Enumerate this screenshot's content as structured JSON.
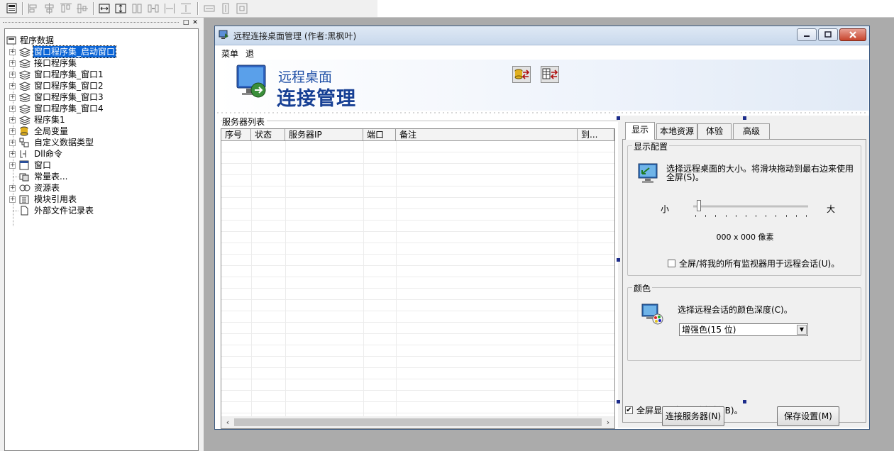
{
  "tree": {
    "root": "程序数据",
    "items": [
      {
        "label": "窗口程序集_启动窗口",
        "expand": "+",
        "selected": true,
        "icon": "layers-icon"
      },
      {
        "label": "接口程序集",
        "expand": "+",
        "icon": "layers-icon"
      },
      {
        "label": "窗口程序集_窗口1",
        "expand": "+",
        "icon": "layers-icon"
      },
      {
        "label": "窗口程序集_窗口2",
        "expand": "+",
        "icon": "layers-icon"
      },
      {
        "label": "窗口程序集_窗口3",
        "expand": "+",
        "icon": "layers-icon"
      },
      {
        "label": "窗口程序集_窗口4",
        "expand": "+",
        "icon": "layers-icon"
      },
      {
        "label": "程序集1",
        "expand": "+",
        "icon": "layers-icon"
      },
      {
        "label": "全局变量",
        "expand": "+",
        "icon": "database-icon"
      },
      {
        "label": "自定义数据类型",
        "expand": "+",
        "icon": "data-type-icon"
      },
      {
        "label": "Dll命令",
        "expand": "+",
        "icon": "dll-icon"
      },
      {
        "label": "窗口",
        "expand": "+",
        "icon": "window-icon"
      },
      {
        "label": "常量表...",
        "expand": "",
        "icon": "constant-icon"
      },
      {
        "label": "资源表",
        "expand": "+",
        "icon": "resource-icon"
      },
      {
        "label": "模块引用表",
        "expand": "+",
        "icon": "module-icon"
      },
      {
        "label": "外部文件记录表",
        "expand": "",
        "icon": "file-icon"
      }
    ]
  },
  "form": {
    "title": "远程连接桌面管理 (作者:黑枫叶)",
    "menu": [
      "菜单",
      "退"
    ],
    "banner_line1": "远程桌面",
    "banner_line2": "连接管理",
    "server_list_label": "服务器列表",
    "columns": [
      "序号",
      "状态",
      "服务器IP",
      "端口",
      "备注",
      "到..."
    ],
    "tabs": [
      "显示",
      "本地资源",
      "体验",
      "高级"
    ],
    "active_tab": "显示",
    "display_group": "显示配置",
    "display_desc": "选择远程桌面的大小。将滑块拖动到最右边来使用全屏(S)。",
    "slider_min": "小",
    "slider_max": "大",
    "slider_value": 0.05,
    "resolution": "000 x 000 像素",
    "all_monitors": "全屏/将我的所有监视器用于远程会话(U)。",
    "all_monitors_checked": false,
    "color_group": "颜色",
    "color_desc": "选择远程会话的颜色深度(C)。",
    "color_value": "增强色(15 位)",
    "show_bar": "全屏显示时显示连接栏(B)。",
    "show_bar_checked": true,
    "check_mark": "✔",
    "connect_button": "连接服务器(N)",
    "save_button": "保存设置(M)"
  }
}
